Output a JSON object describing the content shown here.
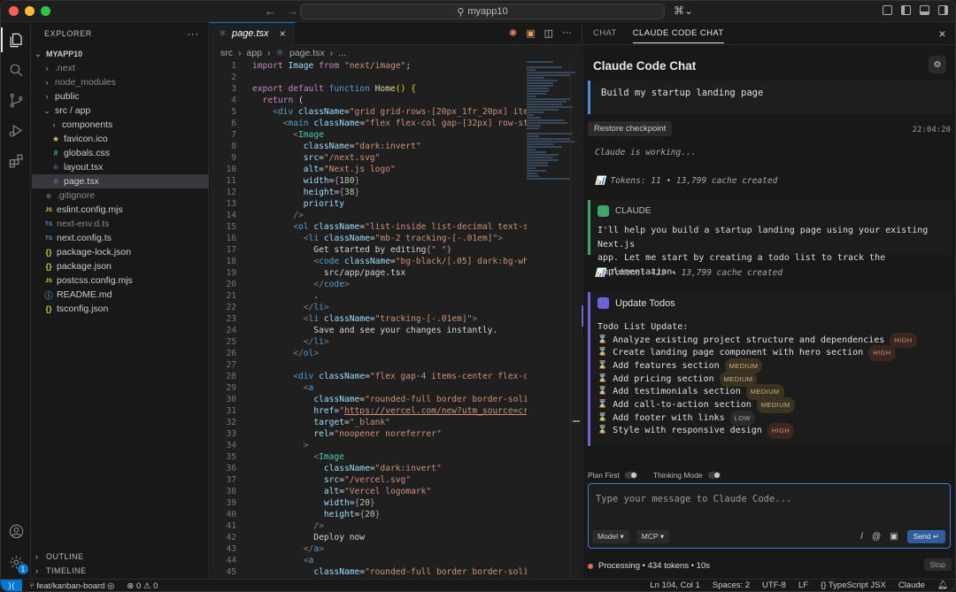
{
  "window": {
    "search_text": "myapp10",
    "copilot_label": "⌘⌄"
  },
  "explorer": {
    "title": "EXPLORER",
    "root": "MYAPP10",
    "items": [
      {
        "label": ".next",
        "kind": "folder",
        "depth": 1
      },
      {
        "label": "node_modules",
        "kind": "folder",
        "depth": 1
      },
      {
        "label": "public",
        "kind": "folder",
        "depth": 1
      },
      {
        "label": "src / app",
        "kind": "folder-open",
        "depth": 1
      },
      {
        "label": "components",
        "kind": "folder",
        "depth": 2
      },
      {
        "label": "favicon.ico",
        "kind": "star",
        "depth": 2
      },
      {
        "label": "globals.css",
        "kind": "css",
        "depth": 2
      },
      {
        "label": "layout.tsx",
        "kind": "tsx",
        "depth": 2
      },
      {
        "label": "page.tsx",
        "kind": "tsx",
        "depth": 2,
        "selected": true
      },
      {
        "label": ".gitignore",
        "kind": "git",
        "depth": 1
      },
      {
        "label": "eslint.config.mjs",
        "kind": "js",
        "depth": 1
      },
      {
        "label": "next-env.d.ts",
        "kind": "ts",
        "depth": 1
      },
      {
        "label": "next.config.ts",
        "kind": "ts",
        "depth": 1
      },
      {
        "label": "package-lock.json",
        "kind": "json",
        "depth": 1
      },
      {
        "label": "package.json",
        "kind": "json",
        "depth": 1
      },
      {
        "label": "postcss.config.mjs",
        "kind": "js",
        "depth": 1
      },
      {
        "label": "README.md",
        "kind": "md",
        "depth": 1
      },
      {
        "label": "tsconfig.json",
        "kind": "json",
        "depth": 1
      }
    ],
    "outline": "OUTLINE",
    "timeline": "TIMELINE"
  },
  "editor": {
    "tab": "page.tsx",
    "breadcrumb": [
      "src",
      "app",
      "page.tsx",
      "..."
    ],
    "lines": [
      "1",
      "2",
      "3",
      "4",
      "5",
      "6",
      "7",
      "8",
      "9",
      "10",
      "11",
      "12",
      "13",
      "14",
      "15",
      "16",
      "17",
      "18",
      "19",
      "20",
      "21",
      "22",
      "23",
      "24",
      "25",
      "26",
      "27",
      "28",
      "29",
      "30",
      "31",
      "32",
      "33",
      "34",
      "35",
      "36",
      "37",
      "38",
      "39",
      "40",
      "41",
      "42",
      "43",
      "44",
      "45"
    ]
  },
  "chat": {
    "tab_chat": "CHAT",
    "tab_claude": "CLAUDE CODE CHAT",
    "title": "Claude Code Chat",
    "user_message": "Build my startup landing page",
    "restore": "Restore checkpoint",
    "time": "22:04:20",
    "working": "Claude is working...",
    "tokens1": "📊 Tokens: 11 • 13,799 cache created",
    "claude_label": "CLAUDE",
    "claude_line1": "I'll help you build a startup landing page using your existing Next.js",
    "claude_line2": "app. Let me start by creating a todo list to track the implementation.",
    "tokens2": "📊 Tokens: 423 • 13,799 cache created",
    "todo_title": "Update Todos",
    "todo_heading": "Todo List Update:",
    "todos": [
      {
        "text": "Analyze existing project structure and dependencies",
        "priority": "HIGH"
      },
      {
        "text": "Create landing page component with hero section",
        "priority": "HIGH"
      },
      {
        "text": "Add features section",
        "priority": "MEDIUM"
      },
      {
        "text": "Add pricing section",
        "priority": "MEDIUM"
      },
      {
        "text": "Add testimonials section",
        "priority": "MEDIUM"
      },
      {
        "text": "Add call-to-action section",
        "priority": "MEDIUM"
      },
      {
        "text": "Add footer with links",
        "priority": "LOW"
      },
      {
        "text": "Style with responsive design",
        "priority": "HIGH"
      }
    ],
    "plan_first": "Plan First",
    "thinking_mode": "Thinking Mode",
    "placeholder": "Type your message to Claude Code...",
    "model_btn": "Model ▾",
    "mcp_btn": "MCP ▾",
    "slash": "/",
    "at": "@",
    "send": "Send ↵",
    "processing": "Processing • 434 tokens • 10s",
    "stop": "Stop"
  },
  "status": {
    "branch": "feat/kanban-board",
    "problems": "⊗ 0 ⚠ 0",
    "position": "Ln 104, Col 1",
    "spaces": "Spaces: 2",
    "encoding": "UTF-8",
    "eol": "LF",
    "language": "{} TypeScript JSX",
    "extension": "Claude"
  }
}
